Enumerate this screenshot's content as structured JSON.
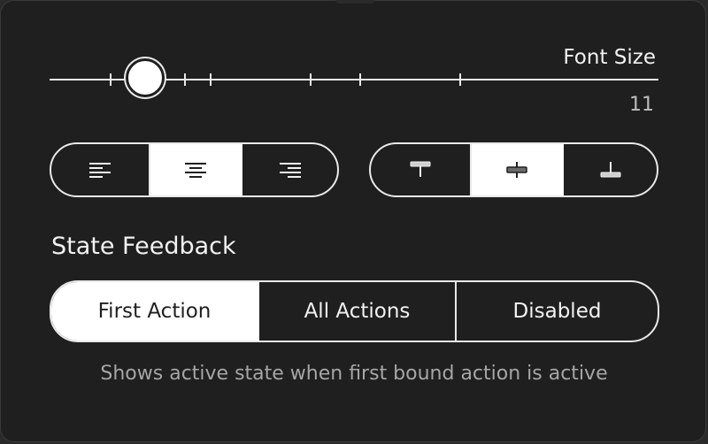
{
  "font_size": {
    "label": "Font Size",
    "value": "11"
  },
  "text_align": {
    "options": [
      {
        "icon": "align-left-icon",
        "selected": false
      },
      {
        "icon": "align-center-icon",
        "selected": true
      },
      {
        "icon": "align-right-icon",
        "selected": false
      }
    ]
  },
  "vertical_align": {
    "options": [
      {
        "icon": "align-top-icon",
        "selected": false
      },
      {
        "icon": "align-middle-icon",
        "selected": true
      },
      {
        "icon": "align-bottom-icon",
        "selected": false
      }
    ]
  },
  "state_feedback": {
    "title": "State Feedback",
    "options": [
      {
        "label": "First Action",
        "selected": true
      },
      {
        "label": "All Actions",
        "selected": false
      },
      {
        "label": "Disabled",
        "selected": false
      }
    ],
    "description": "Shows active state when first bound action is active"
  },
  "colors": {
    "panel_bg": "#1f1f1f",
    "foreground": "#f2f2f2",
    "selected_bg": "#ffffff",
    "muted_text": "#a6a6a6"
  }
}
